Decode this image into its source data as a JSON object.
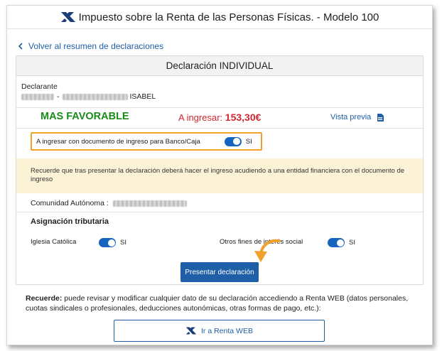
{
  "header": {
    "title": "Impuesto sobre la Renta de las Personas Físicas. - Modelo 100",
    "logo_icon": "aeat-logo-icon"
  },
  "nav": {
    "back_label": "Volver al resumen de declaraciones"
  },
  "card": {
    "title": "Declaración INDIVIDUAL",
    "declarante_label": "Declarante",
    "declarante_name_visible": "ISABEL",
    "declarante_separator": "-",
    "result_label": "MAS FAVORABLE",
    "ingresar_label": "A ingresar:",
    "ingresar_amount": "153,30€",
    "vista_previa_label": "Vista previa",
    "ingreso_option_label": "A ingresar con documento de ingreso para Banco/Caja",
    "ingreso_option_value": "SI",
    "notice_text": "Recuerde que tras presentar la declaración deberá hacer el ingreso acudiendo a una entidad financiera con el documento de ingreso",
    "comunidad_label": "Comunidad Autónoma :",
    "asignacion_title": "Asignación tributaria",
    "iglesia_label": "Iglesia Católica",
    "iglesia_value": "SI",
    "otros_label": "Otros fines de interés social",
    "otros_value": "SI",
    "submit_label": "Presentar declaración"
  },
  "footer": {
    "recuerde_bold": "Recuerde:",
    "recuerde_text": " puede revisar y modificar cualquier dato de su declaración accediendo a Renta WEB (datos personales, cuotas sindicales o profesionales, deducciones autonómicas, otras formas de pago, etc.):",
    "renta_button_label": "Ir a Renta WEB"
  },
  "colors": {
    "accent": "#1f5fa8",
    "favorable": "#1a8a1a",
    "amount": "#d0282e",
    "highlight_border": "#f0a12a",
    "notice_bg": "#fcf3d6"
  }
}
